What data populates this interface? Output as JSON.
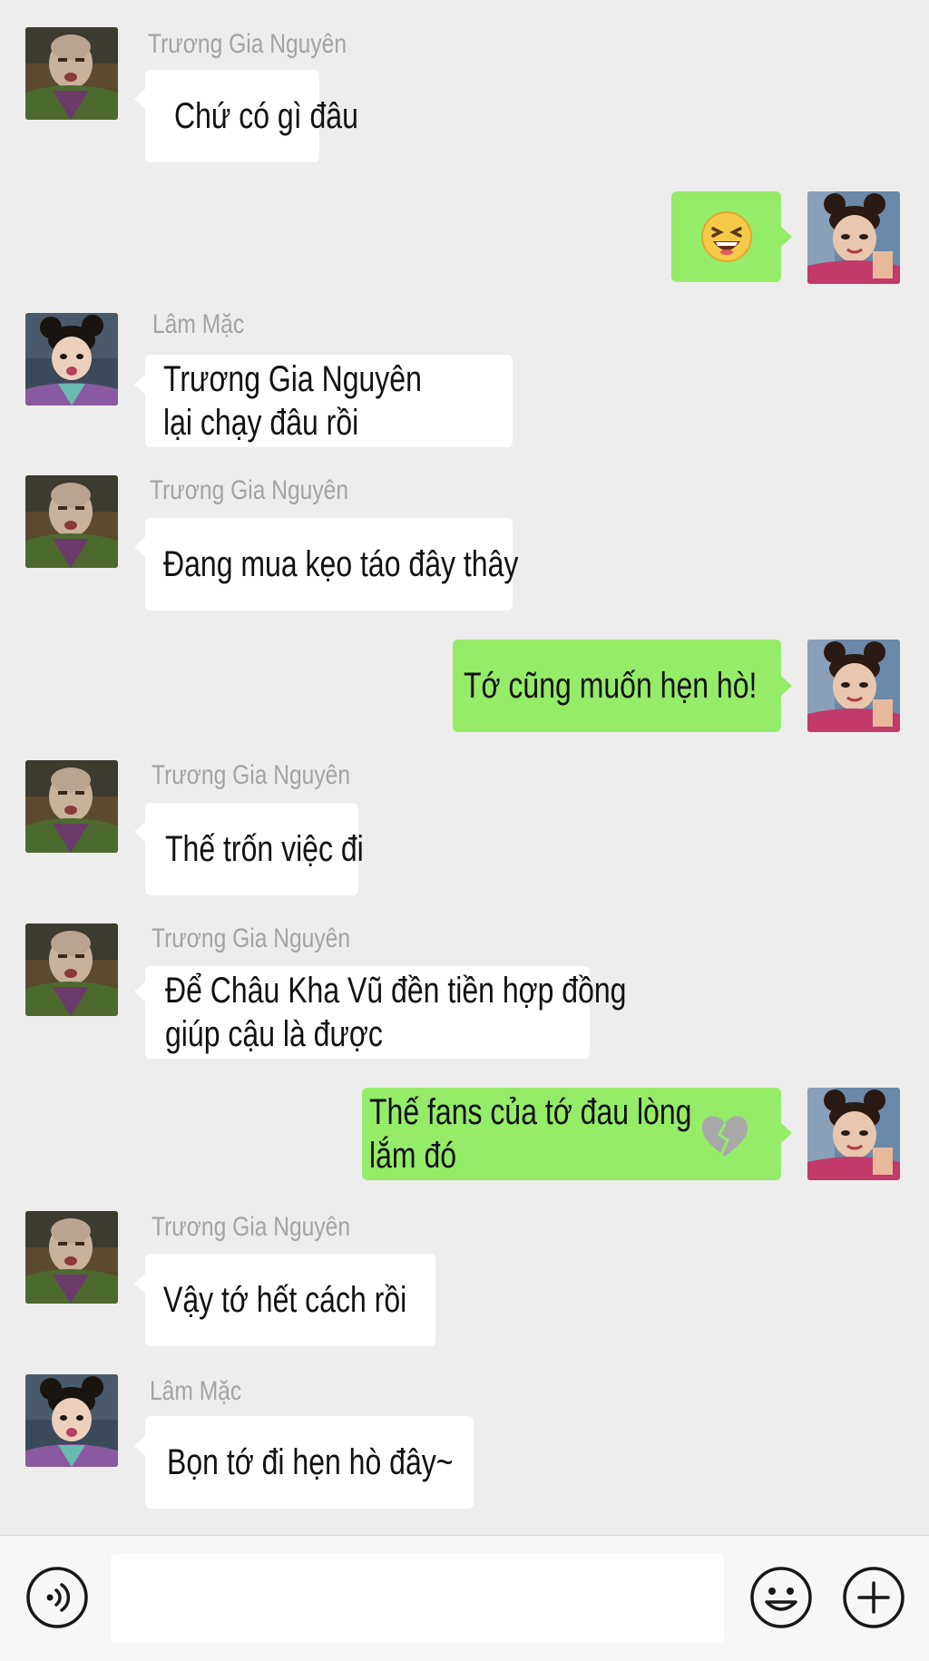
{
  "app": {
    "colors": {
      "background": "#ededed",
      "bubble_incoming": "#ffffff",
      "bubble_outgoing": "#95ec69",
      "sender_name": "#a3a3a3",
      "text": "#111111"
    }
  },
  "messages": [
    {
      "sender": "Trương Gia Nguyên",
      "direction": "incoming",
      "avatar": "shaved-head-man-avatar",
      "text": "Chứ có gì đâu"
    },
    {
      "sender": "",
      "direction": "outgoing",
      "avatar": "girl-with-buns-avatar",
      "text": "",
      "emoji": "laughing-squinting-emoji"
    },
    {
      "sender": "Lâm Mặc",
      "direction": "incoming",
      "avatar": "girl-surprised-avatar",
      "text": "Trương Gia Nguyên\nlại chạy đâu rồi"
    },
    {
      "sender": "Trương Gia Nguyên",
      "direction": "incoming",
      "avatar": "shaved-head-man-avatar",
      "text": "Đang mua kẹo táo đây thây"
    },
    {
      "sender": "",
      "direction": "outgoing",
      "avatar": "girl-with-buns-avatar",
      "text": "Tớ cũng muốn hẹn hò!"
    },
    {
      "sender": "Trương Gia Nguyên",
      "direction": "incoming",
      "avatar": "shaved-head-man-avatar",
      "text": "Thế trốn việc đi"
    },
    {
      "sender": "Trương Gia Nguyên",
      "direction": "incoming",
      "avatar": "shaved-head-man-avatar",
      "text": "Để Châu Kha Vũ đền tiền hợp đồng\ngiúp cậu là được"
    },
    {
      "sender": "",
      "direction": "outgoing",
      "avatar": "girl-with-buns-avatar",
      "text": "Thế fans của tớ đau lòng\nlắm đó",
      "emoji": "broken-heart-emoji"
    },
    {
      "sender": "Trương Gia Nguyên",
      "direction": "incoming",
      "avatar": "shaved-head-man-avatar",
      "text": "Vậy tớ hết cách rồi"
    },
    {
      "sender": "Lâm Mặc",
      "direction": "incoming",
      "avatar": "girl-surprised-avatar",
      "text": "Bọn tớ đi hẹn hò đây~"
    }
  ],
  "input_bar": {
    "voice_icon": "voice-wave-icon",
    "input_value": "",
    "emoji_icon": "smiley-icon",
    "add_icon": "plus-circle-icon"
  }
}
